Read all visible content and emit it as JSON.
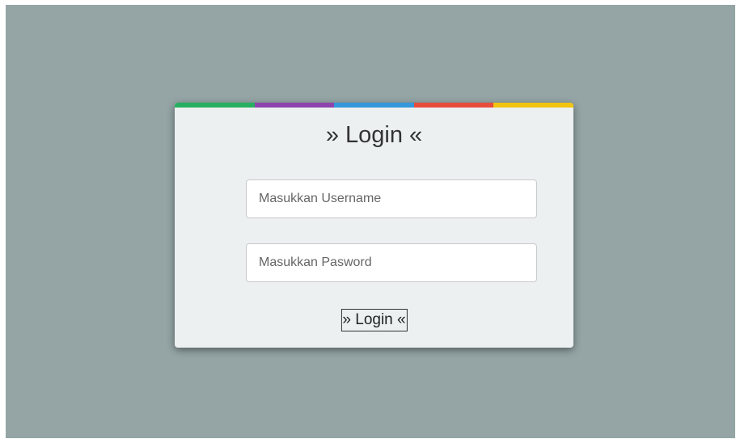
{
  "colors": {
    "background": "#95a5a6",
    "card": "#ecf0f1",
    "strip": [
      "#27ae60",
      "#8e44ad",
      "#3498db",
      "#e74c3c",
      "#f1c40f"
    ]
  },
  "login": {
    "title": "» Login «",
    "username_placeholder": "Masukkan Username",
    "password_placeholder": "Masukkan Pasword",
    "submit_label": "» Login «"
  }
}
